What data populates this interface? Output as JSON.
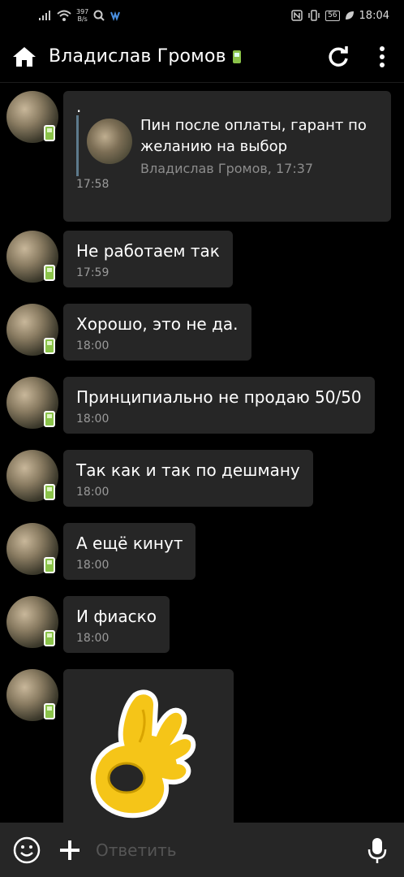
{
  "status_bar": {
    "speed_value": "397",
    "speed_unit": "B/s",
    "battery": "56",
    "time": "18:04"
  },
  "header": {
    "title": "Владислав Громов"
  },
  "messages": [
    {
      "text": ".",
      "quote": {
        "text": "Пин после оплаты, гарант по желанию на выбор",
        "author": "Владислав Громов, 17:37"
      },
      "time": "17:58"
    },
    {
      "text": "Не работаем так",
      "time": "17:59"
    },
    {
      "text": "Хорошо, это не да.",
      "time": "18:00"
    },
    {
      "text": "Принципиально не продаю 50/50",
      "time": "18:00"
    },
    {
      "text": "Так как и так по дешману",
      "time": "18:00"
    },
    {
      "text": "А ещё кинут",
      "time": "18:00"
    },
    {
      "text": "И фиаско",
      "time": "18:00"
    },
    {
      "sticker": "ok-hand-sticker"
    }
  ],
  "composer": {
    "placeholder": "Ответить"
  }
}
